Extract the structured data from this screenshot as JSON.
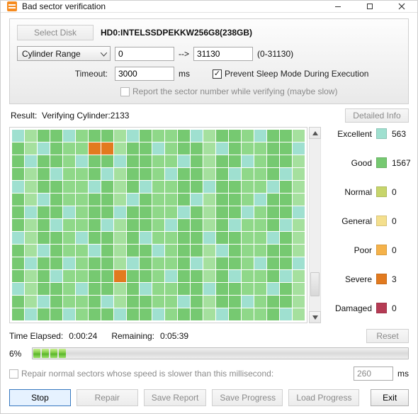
{
  "window": {
    "title": "Bad sector verification"
  },
  "toolbar": {
    "select_disk_label": "Select Disk",
    "disk_name": "HD0:INTELSSDPEKKW256G8(238GB)"
  },
  "range_row": {
    "combo_label": "Cylinder Range",
    "from_value": "0",
    "arrow": "-->",
    "to_value": "31130",
    "hint": "(0-31130)"
  },
  "timeout_row": {
    "label": "Timeout:",
    "value": "3000",
    "unit": "ms",
    "prevent_sleep_label": "Prevent Sleep Mode During Execution",
    "prevent_sleep_checked": true
  },
  "report_row": {
    "label": "Report the sector number while verifying (maybe slow)",
    "checked": false
  },
  "result": {
    "label": "Result:",
    "status_text": "Verifying Cylinder:2133",
    "detailed_info_label": "Detailed Info"
  },
  "legend": {
    "items": [
      {
        "name": "Excellent",
        "swatch": "sw-excellent",
        "count": "563"
      },
      {
        "name": "Good",
        "swatch": "sw-good",
        "count": "1567"
      },
      {
        "name": "Normal",
        "swatch": "sw-normal",
        "count": "0"
      },
      {
        "name": "General",
        "swatch": "sw-general",
        "count": "0"
      },
      {
        "name": "Poor",
        "swatch": "sw-poor",
        "count": "0"
      },
      {
        "name": "Severe",
        "swatch": "sw-severe",
        "count": "3"
      },
      {
        "name": "Damaged",
        "swatch": "sw-damaged",
        "count": "0"
      }
    ]
  },
  "grid": {
    "cols": 23,
    "rows": 15,
    "severe_cells": [
      {
        "row": 1,
        "col": 6
      },
      {
        "row": 1,
        "col": 7
      },
      {
        "row": 11,
        "col": 8
      }
    ],
    "excellent_cells": [
      {
        "row": 0,
        "col": 0
      },
      {
        "row": 0,
        "col": 4
      },
      {
        "row": 0,
        "col": 9
      },
      {
        "row": 0,
        "col": 14
      },
      {
        "row": 0,
        "col": 19
      },
      {
        "row": 1,
        "col": 2
      },
      {
        "row": 1,
        "col": 11
      },
      {
        "row": 1,
        "col": 16
      },
      {
        "row": 1,
        "col": 22
      },
      {
        "row": 2,
        "col": 1
      },
      {
        "row": 2,
        "col": 5
      },
      {
        "row": 2,
        "col": 8
      },
      {
        "row": 2,
        "col": 13
      },
      {
        "row": 2,
        "col": 18
      },
      {
        "row": 3,
        "col": 3
      },
      {
        "row": 3,
        "col": 7
      },
      {
        "row": 3,
        "col": 12
      },
      {
        "row": 3,
        "col": 17
      },
      {
        "row": 3,
        "col": 21
      },
      {
        "row": 4,
        "col": 0
      },
      {
        "row": 4,
        "col": 6
      },
      {
        "row": 4,
        "col": 10
      },
      {
        "row": 4,
        "col": 15
      },
      {
        "row": 4,
        "col": 20
      },
      {
        "row": 5,
        "col": 2
      },
      {
        "row": 5,
        "col": 9
      },
      {
        "row": 5,
        "col": 14
      },
      {
        "row": 5,
        "col": 19
      },
      {
        "row": 6,
        "col": 1
      },
      {
        "row": 6,
        "col": 4
      },
      {
        "row": 6,
        "col": 8
      },
      {
        "row": 6,
        "col": 13
      },
      {
        "row": 6,
        "col": 18
      },
      {
        "row": 6,
        "col": 22
      },
      {
        "row": 7,
        "col": 3
      },
      {
        "row": 7,
        "col": 7
      },
      {
        "row": 7,
        "col": 12
      },
      {
        "row": 7,
        "col": 17
      },
      {
        "row": 7,
        "col": 21
      },
      {
        "row": 8,
        "col": 0
      },
      {
        "row": 8,
        "col": 5
      },
      {
        "row": 8,
        "col": 10
      },
      {
        "row": 8,
        "col": 15
      },
      {
        "row": 8,
        "col": 20
      },
      {
        "row": 9,
        "col": 2
      },
      {
        "row": 9,
        "col": 6
      },
      {
        "row": 9,
        "col": 11
      },
      {
        "row": 9,
        "col": 16
      },
      {
        "row": 10,
        "col": 1
      },
      {
        "row": 10,
        "col": 4
      },
      {
        "row": 10,
        "col": 9
      },
      {
        "row": 10,
        "col": 14
      },
      {
        "row": 10,
        "col": 19
      },
      {
        "row": 10,
        "col": 22
      },
      {
        "row": 11,
        "col": 3
      },
      {
        "row": 11,
        "col": 12
      },
      {
        "row": 11,
        "col": 17
      },
      {
        "row": 11,
        "col": 21
      },
      {
        "row": 12,
        "col": 0
      },
      {
        "row": 12,
        "col": 5
      },
      {
        "row": 12,
        "col": 10
      },
      {
        "row": 12,
        "col": 15
      },
      {
        "row": 12,
        "col": 20
      },
      {
        "row": 13,
        "col": 2
      },
      {
        "row": 13,
        "col": 7
      },
      {
        "row": 13,
        "col": 13
      },
      {
        "row": 13,
        "col": 18
      },
      {
        "row": 14,
        "col": 1
      },
      {
        "row": 14,
        "col": 4
      },
      {
        "row": 14,
        "col": 8
      },
      {
        "row": 14,
        "col": 11
      },
      {
        "row": 14,
        "col": 16
      },
      {
        "row": 14,
        "col": 21
      }
    ]
  },
  "time": {
    "elapsed_label": "Time Elapsed:",
    "elapsed_value": "0:00:24",
    "remaining_label": "Remaining:",
    "remaining_value": "0:05:39",
    "reset_label": "Reset",
    "percent_text": "6%",
    "percent": 6
  },
  "threshold": {
    "checked": false,
    "label": "Repair normal sectors whose speed is slower than this millisecond:",
    "value": "260",
    "unit": "ms"
  },
  "buttons": {
    "stop": "Stop",
    "repair": "Repair",
    "save_report": "Save Report",
    "save_progress": "Save Progress",
    "load_progress": "Load Progress",
    "exit": "Exit"
  }
}
